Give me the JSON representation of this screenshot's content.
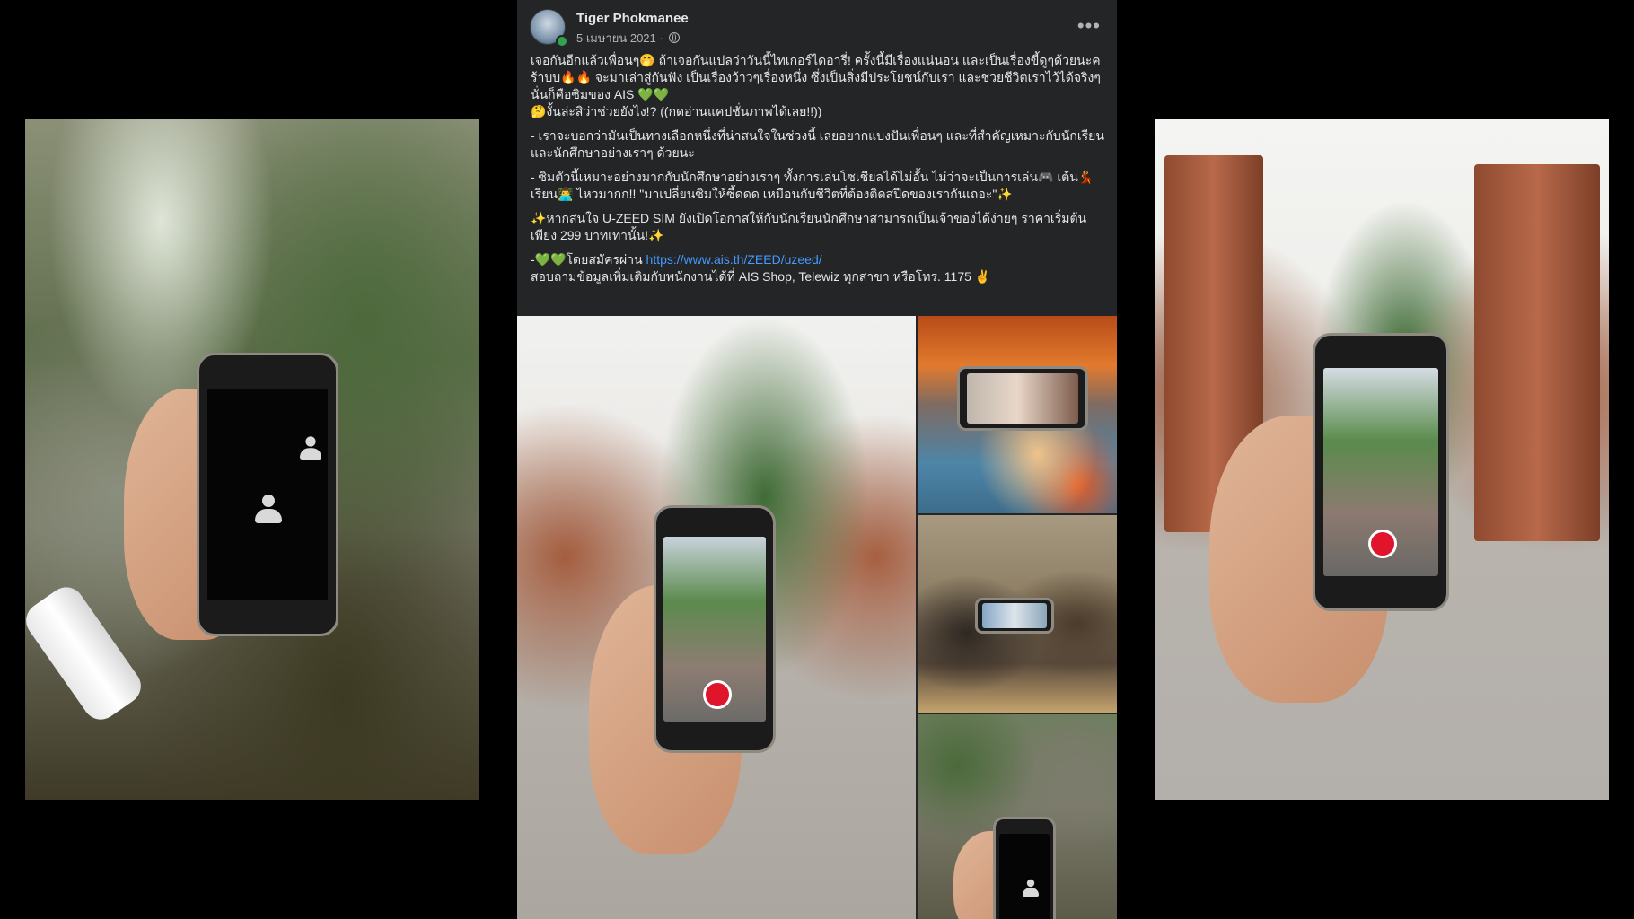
{
  "post": {
    "author": "Tiger Phokmanee",
    "date": "5 เมษายน 2021",
    "more_icon": "•••",
    "paragraphs": [
      "เจอกันอีกแล้วเพื่อนๆ🤭 ถ้าเจอกันแปลว่าวันนี้ไทเกอร์ไดอารี่! ครั้งนี้มีเรื่องแน่นอน และเป็นเรื่องขี้ดูๆด้วยนะค ร้าบบ🔥🔥 จะมาเล่าสู่กันฟัง เป็นเรื่องว้าวๆเรื่องหนึ่ง ซึ่งเป็นสิ่งมีประโยชน์กับเรา และช่วยชีวิตเราไว้ได้จริงๆ นั่นก็คือซิมของ AIS 💚💚",
      "🤔งั้นล่ะสิว่าช่วยยังไง!? ((กดอ่านแคปชั่นภาพได้เลย!!))",
      "- เราจะบอกว่ามันเป็นทางเลือกหนึ่งที่น่าสนใจในช่วงนี้ เลยอยากแบ่งปันเพื่อนๆ และที่สำคัญเหมาะกับนักเรียนและนักศึกษาอย่างเราๆ ด้วยนะ",
      "- ซิมตัวนี้เหมาะอย่างมากกับนักศึกษาอย่างเราๆ ทั้งการเล่นโซเชียลได้ไม่อั้น ไม่ว่าจะเป็นการเล่น🎮 เต้น💃 เรียน👨‍💻 ไหวมากก!! \"มาเปลี่ยนซิมให้ซี้ดดด เหมือนกับชีวิตที่ต้องติดสปีดของเรากันเถอะ\"✨",
      "✨หากสนใจ U-ZEED SIM ยังเปิดโอกาสให้กับนักเรียนนักศึกษาสามารถเป็นเจ้าของได้ง่ายๆ ราคาเริ่มต้นเพียง 299 บาทเท่านั้น!✨"
    ],
    "signup_prefix": "-💚💚โดยสมัครผ่าน ",
    "signup_link": "https://www.ais.th/ZEED/uzeed/",
    "contact_line": "สอบถามข้อมูลเพิ่มเติมกับพนักงานได้ที่ AIS Shop, Telewiz ทุกสาขา หรือโทร. 1175 ✌️"
  },
  "icons": {
    "avatar": "avatar",
    "privacy": "globe-icon",
    "more": "more-options-icon",
    "participant": "person-icon",
    "record": "record-button"
  },
  "colors": {
    "post_bg": "#242526",
    "text": "#e4e6eb",
    "meta": "#b0b3b8",
    "link": "#4599ff",
    "online": "#31a24c"
  }
}
